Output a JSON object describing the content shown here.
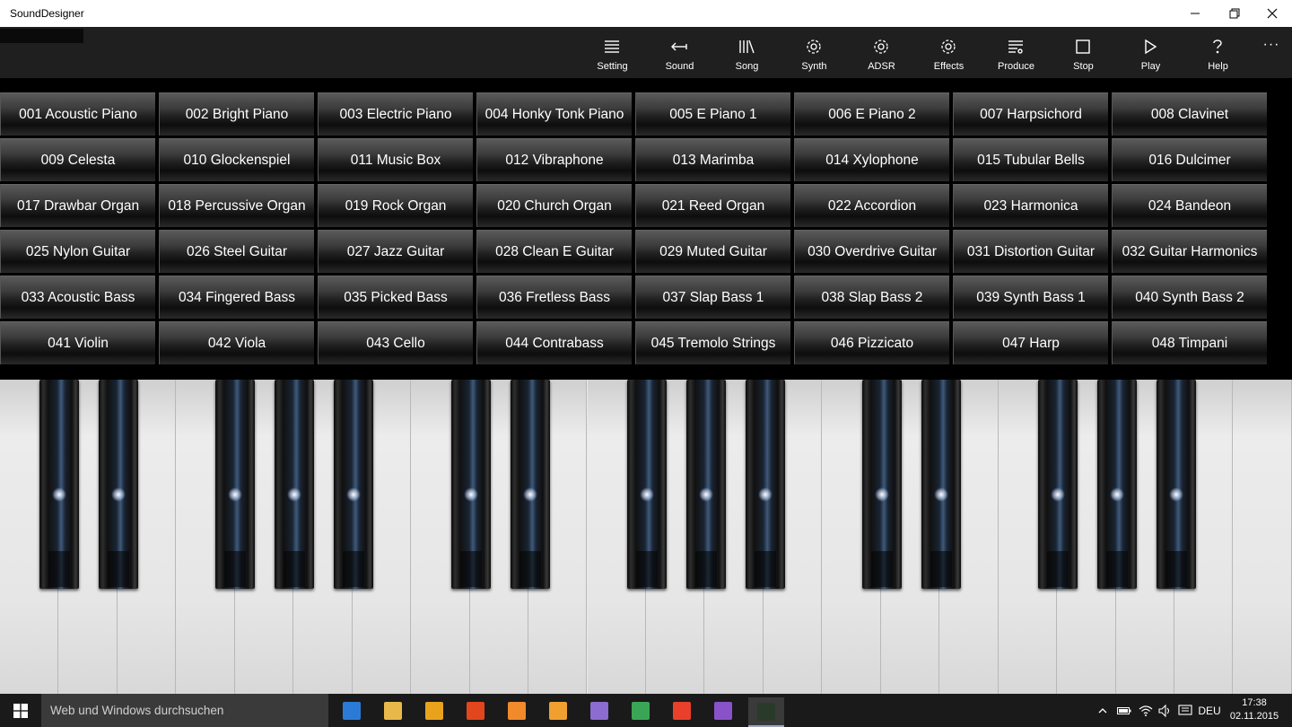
{
  "window": {
    "title": "SoundDesigner"
  },
  "commands": [
    {
      "label": "Setting",
      "icon": "list-icon"
    },
    {
      "label": "Sound",
      "icon": "arrow-left-icon"
    },
    {
      "label": "Song",
      "icon": "library-icon"
    },
    {
      "label": "Synth",
      "icon": "gear-icon"
    },
    {
      "label": "ADSR",
      "icon": "gear-icon"
    },
    {
      "label": "Effects",
      "icon": "gear-icon"
    },
    {
      "label": "Produce",
      "icon": "playlist-icon"
    },
    {
      "label": "Stop",
      "icon": "stop-icon"
    },
    {
      "label": "Play",
      "icon": "play-icon"
    },
    {
      "label": "Help",
      "icon": "help-icon"
    }
  ],
  "more_label": "···",
  "instruments": [
    "001 Acoustic Piano",
    "002 Bright Piano",
    "003 Electric Piano",
    "004 Honky Tonk Piano",
    "005 E Piano 1",
    "006 E Piano 2",
    "007 Harpsichord",
    "008 Clavinet",
    "009 Celesta",
    "010 Glockenspiel",
    "011 Music Box",
    "012 Vibraphone",
    "013 Marimba",
    "014 Xylophone",
    "015 Tubular Bells",
    "016 Dulcimer",
    "017 Drawbar Organ",
    "018 Percussive Organ",
    "019 Rock Organ",
    "020 Church Organ",
    "021 Reed Organ",
    "022 Accordion",
    "023 Harmonica",
    "024 Bandeon",
    "025 Nylon Guitar",
    "026 Steel Guitar",
    "027 Jazz Guitar",
    "028 Clean E Guitar",
    "029 Muted Guitar",
    "030 Overdrive Guitar",
    "031 Distortion Guitar",
    "032 Guitar Harmonics",
    "033 Acoustic Bass",
    "034 Fingered Bass",
    "035 Picked Bass",
    "036 Fretless Bass",
    "037 Slap Bass 1",
    "038 Slap Bass 2",
    "039 Synth Bass 1",
    "040 Synth Bass 2",
    "041 Violin",
    "042 Viola",
    "043 Cello",
    "044 Contrabass",
    "045 Tremolo Strings",
    "046 Pizzicato",
    "047 Harp",
    "048 Timpani"
  ],
  "taskbar": {
    "search_placeholder": "Web und Windows durchsuchen",
    "apps": [
      {
        "name": "edge-icon",
        "color": "#2b7bd6"
      },
      {
        "name": "file-explorer-icon",
        "color": "#e8b84a"
      },
      {
        "name": "store-icon",
        "color": "#e8a21c"
      },
      {
        "name": "office-icon",
        "color": "#e2461c"
      },
      {
        "name": "paint-icon",
        "color": "#f08a2a"
      },
      {
        "name": "media-player-icon",
        "color": "#f0a030"
      },
      {
        "name": "photos-icon",
        "color": "#8c6cd0"
      },
      {
        "name": "chrome-icon",
        "color": "#3aa655"
      },
      {
        "name": "windows-logo-icon",
        "color": "#e8402a"
      },
      {
        "name": "visual-studio-icon",
        "color": "#8a52c8"
      },
      {
        "name": "sound-designer-icon",
        "color": "#2a3a2a"
      }
    ],
    "language": "DEU",
    "time": "17:38",
    "date": "02.11.2015"
  }
}
